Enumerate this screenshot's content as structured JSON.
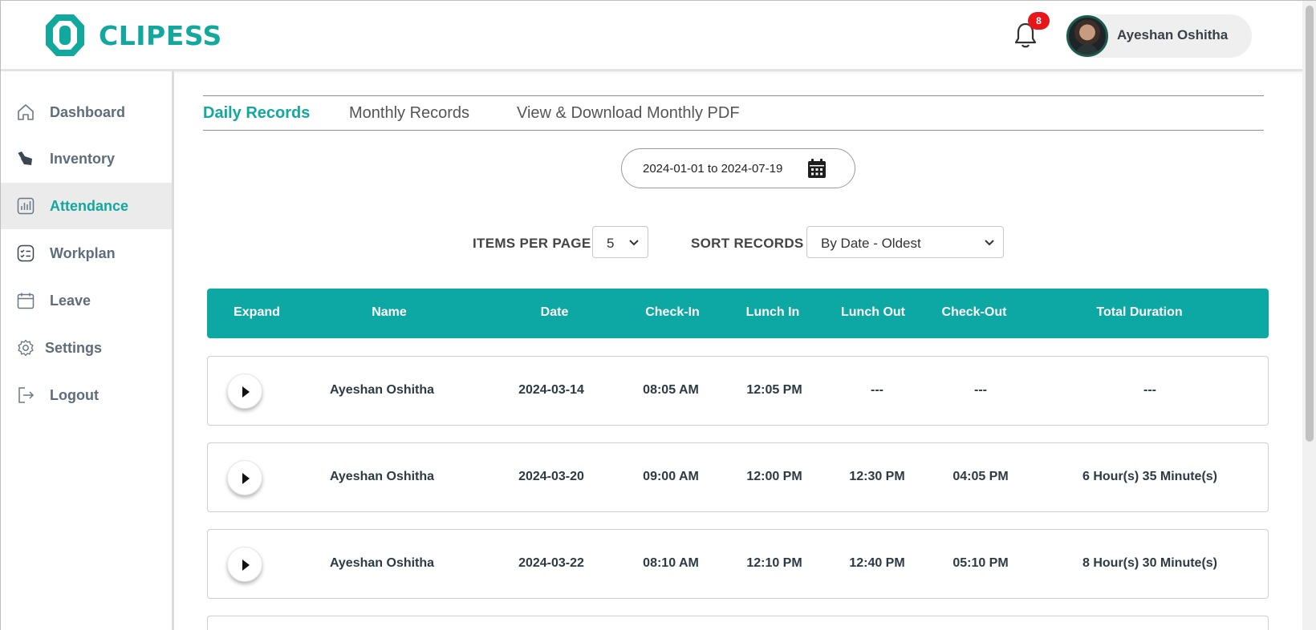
{
  "header": {
    "brand": "CLIPESS",
    "notification_count": "8",
    "user_name": "Ayeshan Oshitha"
  },
  "sidebar": {
    "items": [
      {
        "label": "Dashboard",
        "icon": "home-icon"
      },
      {
        "label": "Inventory",
        "icon": "box-icon"
      },
      {
        "label": "Attendance",
        "icon": "chart-icon",
        "active": true
      },
      {
        "label": "Workplan",
        "icon": "checklist-icon"
      },
      {
        "label": "Leave",
        "icon": "calendar-icon"
      },
      {
        "label": "Settings",
        "icon": "gear-icon"
      },
      {
        "label": "Logout",
        "icon": "logout-icon"
      }
    ]
  },
  "tabs": [
    {
      "label": "Daily Records",
      "active": true
    },
    {
      "label": "Monthly Records"
    },
    {
      "label": "View & Download Monthly PDF"
    }
  ],
  "filters": {
    "date_range": "2024-01-01 to 2024-07-19",
    "items_per_page_label": "ITEMS PER PAGE",
    "items_per_page_value": "5",
    "sort_label": "SORT RECORDS",
    "sort_value": "By Date - Oldest"
  },
  "table": {
    "columns": [
      "Expand",
      "Name",
      "Date",
      "Check-In",
      "Lunch In",
      "Lunch Out",
      "Check-Out",
      "Total Duration"
    ],
    "rows": [
      {
        "name": "Ayeshan Oshitha",
        "date": "2024-03-14",
        "check_in": "08:05 AM",
        "lunch_in": "12:05 PM",
        "lunch_out": "---",
        "check_out": "---",
        "total": "---"
      },
      {
        "name": "Ayeshan Oshitha",
        "date": "2024-03-20",
        "check_in": "09:00 AM",
        "lunch_in": "12:00 PM",
        "lunch_out": "12:30 PM",
        "check_out": "04:05 PM",
        "total": "6 Hour(s) 35 Minute(s)"
      },
      {
        "name": "Ayeshan Oshitha",
        "date": "2024-03-22",
        "check_in": "08:10 AM",
        "lunch_in": "12:10 PM",
        "lunch_out": "12:40 PM",
        "check_out": "05:10 PM",
        "total": "8 Hour(s) 30 Minute(s)"
      }
    ]
  },
  "colors": {
    "accent": "#12a89d",
    "table_header": "#0ea8a4",
    "badge": "#e8151b"
  }
}
